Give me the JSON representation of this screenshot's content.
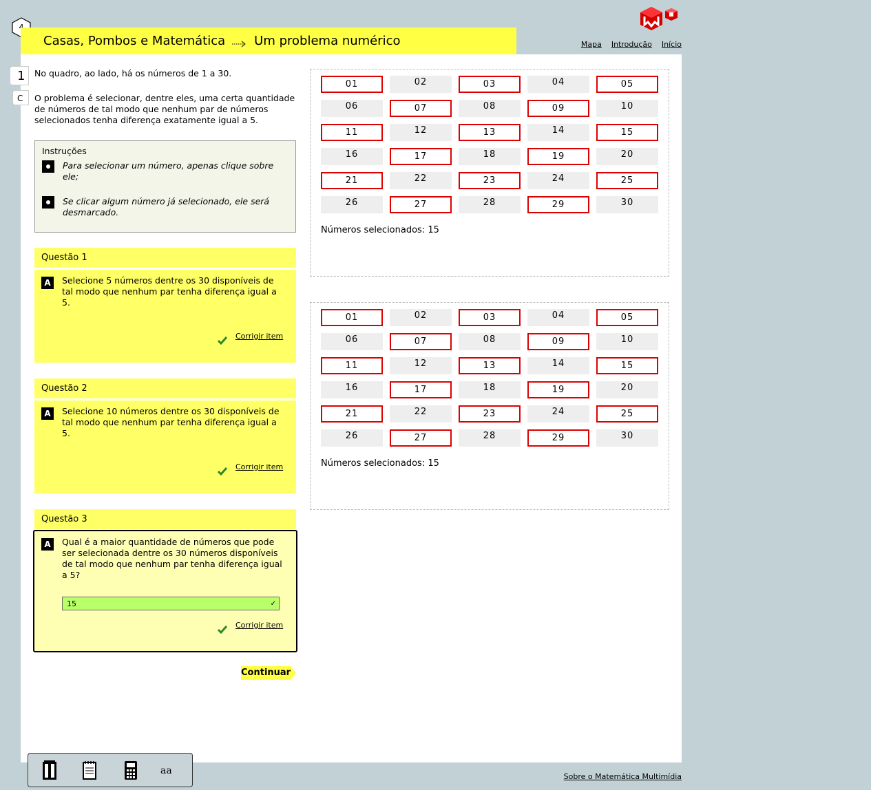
{
  "header": {
    "badge": "4",
    "title_part1": "Casas, Pombos e Matemática",
    "title_part2": "Um problema numérico"
  },
  "nav": {
    "mapa": "Mapa",
    "introducao": "Introdução",
    "inicio": "Início"
  },
  "sidetabs": [
    "1",
    "C"
  ],
  "intro": {
    "p1": "No quadro, ao lado, há os números de 1 a 30.",
    "p2": "O problema é selecionar, dentre eles, uma certa quantidade de números de tal modo que nenhum par de números selecionados tenha diferença exatamente igual a 5."
  },
  "instructions": {
    "title": "Instruções",
    "items": [
      "Para selecionar um número, apenas clique sobre ele;",
      "Se clicar algum número já selecionado, ele será desmarcado."
    ]
  },
  "questions": [
    {
      "title": "Questão 1",
      "letter": "A",
      "text": "Selecione 5 números dentre os 30 disponíveis de tal modo que nenhum par tenha diferença igual a 5.",
      "corrigir": "Corrigir item"
    },
    {
      "title": "Questão 2",
      "letter": "A",
      "text": "Selecione 10 números dentre os 30 disponíveis de tal modo que nenhum par tenha diferença igual a 5.",
      "corrigir": "Corrigir item"
    },
    {
      "title": "Questão 3",
      "letter": "A",
      "text": "Qual é a maior quantidade de números que pode ser selecionada dentre os 30 números disponíveis de tal modo que nenhum par tenha diferença igual a 5?",
      "answer": "15",
      "corrigir": "Corrigir item"
    }
  ],
  "continuar": "Continuar",
  "grids": [
    {
      "numbers": [
        "01",
        "02",
        "03",
        "04",
        "05",
        "06",
        "07",
        "08",
        "09",
        "10",
        "11",
        "12",
        "13",
        "14",
        "15",
        "16",
        "17",
        "18",
        "19",
        "20",
        "21",
        "22",
        "23",
        "24",
        "25",
        "26",
        "27",
        "28",
        "29",
        "30"
      ],
      "selected": [
        "01",
        "03",
        "05",
        "07",
        "09",
        "11",
        "13",
        "15",
        "17",
        "19",
        "21",
        "23",
        "25",
        "27",
        "29"
      ],
      "label": "Números selecionados",
      "count": ": 15"
    },
    {
      "numbers": [
        "01",
        "02",
        "03",
        "04",
        "05",
        "06",
        "07",
        "08",
        "09",
        "10",
        "11",
        "12",
        "13",
        "14",
        "15",
        "16",
        "17",
        "18",
        "19",
        "20",
        "21",
        "22",
        "23",
        "24",
        "25",
        "26",
        "27",
        "28",
        "29",
        "30"
      ],
      "selected": [
        "01",
        "03",
        "05",
        "07",
        "09",
        "11",
        "13",
        "15",
        "17",
        "19",
        "21",
        "23",
        "25",
        "27",
        "29"
      ],
      "label": "Números selecionados",
      "count": ": 15"
    }
  ],
  "footer": {
    "sobre": "Sobre o Matemática Multimídia"
  },
  "toolbar": {
    "font_tool": "aa"
  },
  "colors": {
    "accent_yellow": "#ffff44",
    "selected_border": "#dd0000",
    "answer_green": "#b8ff6a",
    "check_green": "#2a8a2a"
  }
}
